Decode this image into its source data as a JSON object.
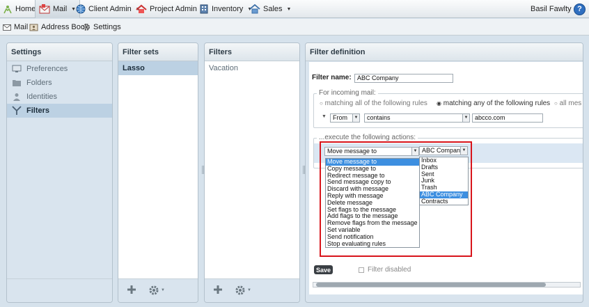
{
  "topnav": {
    "home": "Home",
    "mail": "Mail",
    "client_admin": "Client Admin",
    "project_admin": "Project Admin",
    "inventory": "Inventory",
    "sales": "Sales",
    "user": "Basil Fawlty",
    "help": "?"
  },
  "subnav": {
    "mail": "Mail",
    "address_book": "Address Book",
    "settings": "Settings"
  },
  "settings_panel": {
    "title": "Settings",
    "items": [
      {
        "label": "Preferences",
        "icon": "monitor-icon"
      },
      {
        "label": "Folders",
        "icon": "folder-icon"
      },
      {
        "label": "Identities",
        "icon": "person-icon"
      },
      {
        "label": "Filters",
        "icon": "filter-icon",
        "selected": true
      }
    ]
  },
  "filter_sets_panel": {
    "title": "Filter sets",
    "items": [
      "Lasso"
    ]
  },
  "filters_panel": {
    "title": "Filters",
    "items": [
      "Vacation"
    ]
  },
  "definition": {
    "title": "Filter definition",
    "name_label": "Filter name:",
    "name_value": "ABC Company",
    "incoming_legend": "For incoming mail:",
    "radio_all": "matching all of the following rules",
    "radio_any": "matching any of the following rules",
    "radio_allmsg": "all mes",
    "rule_header": "From",
    "rule_op": "contains",
    "rule_value": "abcco.com",
    "actions_legend": "...execute the following actions:",
    "action_value": "Move message to",
    "folder_value": "ABC Company",
    "action_options": [
      "Move message to",
      "Copy message to",
      "Redirect message to",
      "Send message copy to",
      "Discard with message",
      "Reply with message",
      "Delete message",
      "Set flags to the message",
      "Add flags to the message",
      "Remove flags from the message",
      "Set variable",
      "Send notification",
      "Stop evaluating rules"
    ],
    "folder_options": [
      "Inbox",
      "Drafts",
      "Sent",
      "Junk",
      "Trash",
      "ABC Company",
      "Contracts"
    ],
    "save_label": "Save",
    "disabled_label": "Filter disabled"
  },
  "colors": {
    "highlight": "#3d8fe0",
    "annotation_box": "#d8141b",
    "selected_row": "#bcd1e3"
  }
}
